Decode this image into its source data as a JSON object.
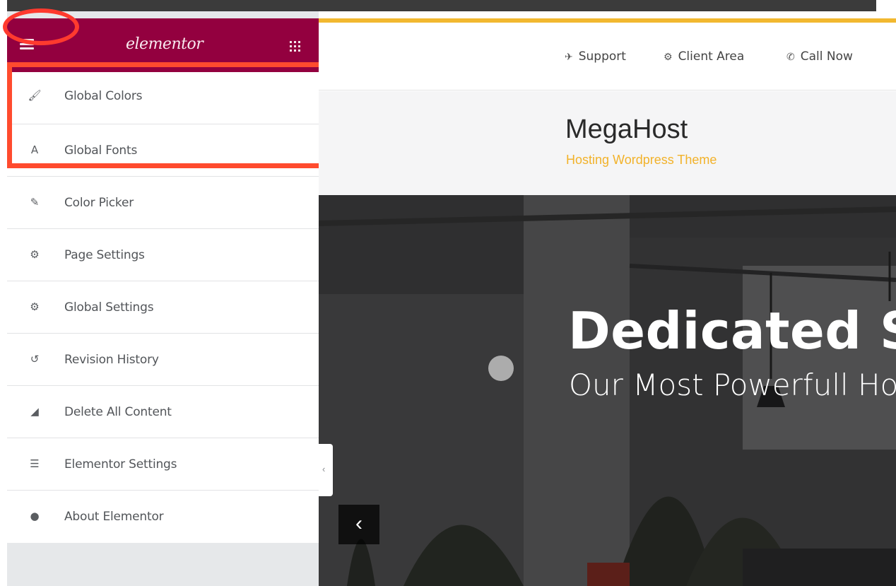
{
  "sidebar": {
    "brand": "elementor",
    "items": [
      {
        "label": "Global Colors",
        "icon": "brush-icon",
        "glyph": "🖌"
      },
      {
        "label": "Global Fonts",
        "icon": "font-icon",
        "glyph": "A"
      },
      {
        "label": "Color Picker",
        "icon": "eyedropper-icon",
        "glyph": "✎"
      },
      {
        "label": "Page Settings",
        "icon": "gear-icon",
        "glyph": "⚙"
      },
      {
        "label": "Global Settings",
        "icon": "cogs-icon",
        "glyph": "⚙"
      },
      {
        "label": "Revision History",
        "icon": "history-icon",
        "glyph": "↺"
      },
      {
        "label": "Delete All Content",
        "icon": "eraser-icon",
        "glyph": "◢"
      },
      {
        "label": "Elementor Settings",
        "icon": "list-icon",
        "glyph": "☰"
      },
      {
        "label": "About Elementor",
        "icon": "info-icon",
        "glyph": "●"
      }
    ],
    "collapse_glyph": "‹"
  },
  "preview": {
    "toplinks": [
      {
        "label": "Support",
        "icon": "plane-icon",
        "glyph": "✈"
      },
      {
        "label": "Client Area",
        "icon": "cogs-icon",
        "glyph": "⚙"
      },
      {
        "label": "Call Now",
        "icon": "phone-icon",
        "glyph": "✆"
      }
    ],
    "logo_title": "MegaHost",
    "logo_subtitle": "Hosting Wordpress Theme",
    "hero_title": "Dedicated S",
    "hero_subtitle": "Our Most Powerfull Hosting",
    "slider_prev_glyph": "‹"
  },
  "colors": {
    "brand": "#93003f",
    "highlight": "#ff4b2e",
    "accent": "#f2b830"
  }
}
